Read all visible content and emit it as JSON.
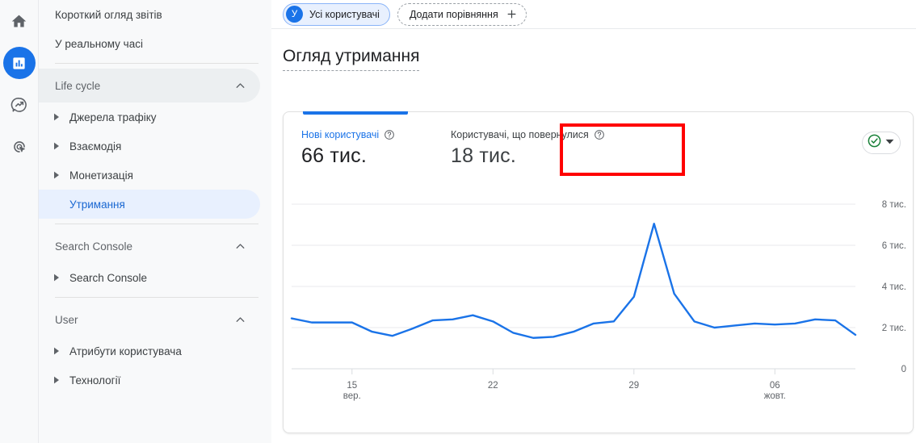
{
  "rail": {
    "items": [
      {
        "name": "home-icon",
        "label": "Home",
        "active": false
      },
      {
        "name": "reports-icon",
        "label": "Reports",
        "active": true
      },
      {
        "name": "explore-icon",
        "label": "Explore",
        "active": false
      },
      {
        "name": "advertising-icon",
        "label": "Advertising",
        "active": false
      }
    ]
  },
  "sidebar": {
    "top_items": [
      {
        "label": "Короткий огляд звітів"
      },
      {
        "label": "У реальному часі"
      }
    ],
    "groups": [
      {
        "title": "Life cycle",
        "hovered": true,
        "items": [
          {
            "label": "Джерела трафіку",
            "selected": false
          },
          {
            "label": "Взаємодія",
            "selected": false
          },
          {
            "label": "Монетизація",
            "selected": false
          },
          {
            "label": "Утримання",
            "selected": true
          }
        ]
      },
      {
        "title": "Search Console",
        "hovered": false,
        "items": [
          {
            "label": "Search Console",
            "selected": false
          }
        ]
      },
      {
        "title": "User",
        "hovered": false,
        "items": [
          {
            "label": "Атрибути користувача",
            "selected": false
          },
          {
            "label": "Технології",
            "selected": false
          }
        ]
      }
    ]
  },
  "topbar": {
    "audience_chip": {
      "avatar": "У",
      "label": "Усі користувачі"
    },
    "add_comparison": {
      "label": "Додати порівняння",
      "icon": "plus-icon"
    }
  },
  "header": {
    "title": "Огляд утримання"
  },
  "card": {
    "metrics": [
      {
        "label": "Нові користувачі",
        "value": "66 тис.",
        "help_icon": "help-circle-icon",
        "highlighted": true
      },
      {
        "label": "Користувачі, що повернулися",
        "value": "18 тис.",
        "help_icon": "help-circle-icon",
        "highlighted": false
      }
    ],
    "actions": {
      "status_icon": "check-circle-icon",
      "dropdown_icon": "chevron-down-icon",
      "status_color": "#188038"
    }
  },
  "colors": {
    "accent": "#1a73e8",
    "selected_bg": "#e8f0fe",
    "annotation": "#ff0000",
    "status_green": "#188038",
    "grid": "#e8eaed"
  },
  "chart_data": {
    "type": "line",
    "title": "",
    "xlabel": "",
    "ylabel": "",
    "ylim": [
      0,
      8800
    ],
    "grid": true,
    "legend": false,
    "ytick_labels": [
      "8 тис.",
      "6 тис.",
      "4 тис.",
      "2 тис.",
      "0"
    ],
    "ytick_values": [
      8000,
      6000,
      4000,
      2000,
      0
    ],
    "xtick_labels": [
      {
        "line1": "15",
        "line2": "вер."
      },
      {
        "line1": "22",
        "line2": ""
      },
      {
        "line1": "29",
        "line2": ""
      },
      {
        "line1": "06",
        "line2": "жовт."
      }
    ],
    "xtick_index": [
      3,
      10,
      17,
      24
    ],
    "series": [
      {
        "name": "Нові користувачі",
        "color": "#1a73e8",
        "values": [
          2450,
          2250,
          2250,
          2250,
          1800,
          1600,
          1950,
          2350,
          2400,
          2600,
          2300,
          1750,
          1500,
          1550,
          1800,
          2200,
          2300,
          3500,
          7050,
          3650,
          2300,
          2000,
          2100,
          2200,
          2150,
          2200,
          2400,
          2350,
          1650
        ]
      }
    ]
  }
}
